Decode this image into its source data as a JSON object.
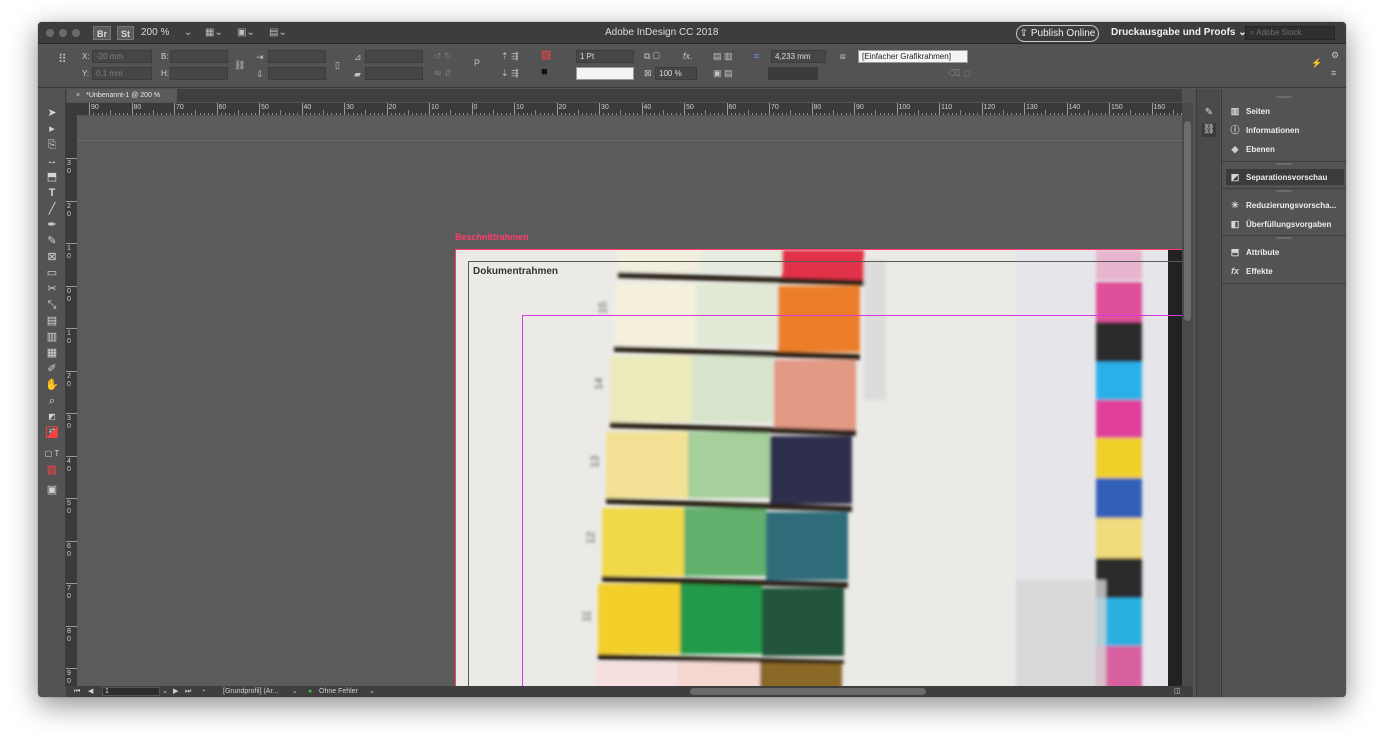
{
  "titlebar": {
    "app_title": "Adobe InDesign CC 2018",
    "bridge_badge": "Br",
    "stock_badge": "St",
    "zoom": "200 %",
    "publish_label": "Publish Online",
    "workspace_label": "Druckausgabe und Proofs",
    "stock_search_placeholder": "Adobe Stock"
  },
  "controlbar": {
    "x_label": "X:",
    "y_label": "Y:",
    "x_value": "-20 mm",
    "y_value": "0,1 mm",
    "w_label": "B:",
    "h_label": "H:",
    "stroke_weight": "1 Pt",
    "scale_value": "100 %",
    "offset_value": "4,233 mm",
    "object_style": "[Einfacher Grafikrahmen]"
  },
  "document": {
    "tab_title": "*Unbenannt-1 @ 200 %",
    "bleed_label": "Beschnittrahmen",
    "document_frame_label": "Dokumentrahmen",
    "h_ruler_ticks": [
      "90",
      "80",
      "70",
      "60",
      "50",
      "40",
      "30",
      "20",
      "10",
      "0",
      "10",
      "20",
      "30",
      "40",
      "50",
      "60",
      "70",
      "80",
      "90",
      "100",
      "110",
      "120",
      "130",
      "140",
      "150",
      "160"
    ],
    "v_ruler_ticks": [
      "3",
      "2",
      "1",
      "0",
      "1",
      "2",
      "3",
      "4",
      "5",
      "6",
      "7",
      "8",
      "9"
    ],
    "chart_row_numbers": [
      "15",
      "14",
      "13",
      "12",
      "11"
    ]
  },
  "statusbar": {
    "page_number": "1",
    "profile": "[Grundprofil] (Ar...",
    "preflight": "Ohne Fehler",
    "preflight_color": "#3fbf3f"
  },
  "panels": {
    "items": [
      {
        "label": "Seiten",
        "icon": "pages-icon"
      },
      {
        "label": "Informationen",
        "icon": "info-icon"
      },
      {
        "label": "Ebenen",
        "icon": "layers-icon"
      },
      {
        "label": "Separationsvorschau",
        "icon": "separations-icon"
      },
      {
        "label": "Reduzierungsvorscha...",
        "icon": "flattener-icon"
      },
      {
        "label": "Überfüllungsvorgaben",
        "icon": "trap-icon"
      },
      {
        "label": "Attribute",
        "icon": "attributes-icon"
      },
      {
        "label": "Effekte",
        "icon": "effects-icon"
      }
    ]
  },
  "colors": {
    "bleed": "#ff3d6e",
    "margin": "#d23bd8",
    "ui_dark": "#535353"
  }
}
